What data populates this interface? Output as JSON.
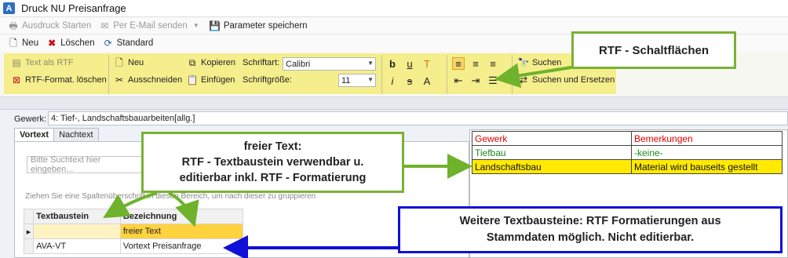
{
  "window": {
    "title": "Druck NU Preisanfrage",
    "app_icon_letter": "A"
  },
  "toolbar1": {
    "ausdruck": "Ausdruck Starten",
    "email": "Per E-Mail senden",
    "save_params": "Parameter speichern"
  },
  "toolbar2": {
    "neu": "Neu",
    "loeschen": "Löschen",
    "standard": "Standard"
  },
  "ribbon": {
    "text_als_rtf": "Text als RTF",
    "rtf_loeschen": "RTF-Format. löschen",
    "neu": "Neu",
    "ausschneiden": "Ausschneiden",
    "kopieren": "Kopieren",
    "einfuegen": "Einfügen",
    "schriftart_label": "Schriftart:",
    "schriftart_value": "Calibri",
    "schriftgroesse_label": "Schriftgröße:",
    "schriftgroesse_value": "11",
    "suchen": "Suchen",
    "suchen_ersetzen": "Suchen und Ersetzen"
  },
  "form": {
    "gewerk_label": "Gewerk:",
    "gewerk_value": "4: Tief-,  Landschaftsbauarbeiten[allg.]",
    "tabs": [
      "Vortext",
      "Nachtext"
    ],
    "search_placeholder": "Bitte Suchtext hier eingeben...",
    "group_hint": "Ziehen Sie eine Spaltenüberschrift in diesen Bereich, um nach dieser zu gruppieren"
  },
  "grid": {
    "headers": [
      "Textbaustein",
      "Bezeichnung"
    ],
    "rows": [
      {
        "textbaustein": "",
        "bezeichnung": "freier Text"
      },
      {
        "textbaustein": "AVA-VT",
        "bezeichnung": "Vortext Preisanfrage"
      }
    ]
  },
  "preview_table": {
    "rows": [
      [
        "Gewerk",
        "Bemerkungen"
      ],
      [
        "Tiefbau",
        "-keine-"
      ],
      [
        "Landschaftsbau",
        "Material wird bauseits gestellt"
      ]
    ]
  },
  "callouts": {
    "rtf": "RTF - Schaltflächen",
    "frei_1": "freier Text:",
    "frei_2": "RTF - Textbaustein verwendbar u.",
    "frei_3": "editierbar inkl. RTF - Formatierung",
    "weitere_1": "Weitere Textbausteine: RTF Formatierungen aus",
    "weitere_2": "Stammdaten möglich. Nicht editierbar."
  },
  "colors": {
    "ribbon_highlight": "#f4ec7a",
    "callout_green": "#7ab133",
    "callout_blue": "#1010d8",
    "selected_row": "#ffd23f",
    "preview_yellow": "#ffea00"
  }
}
